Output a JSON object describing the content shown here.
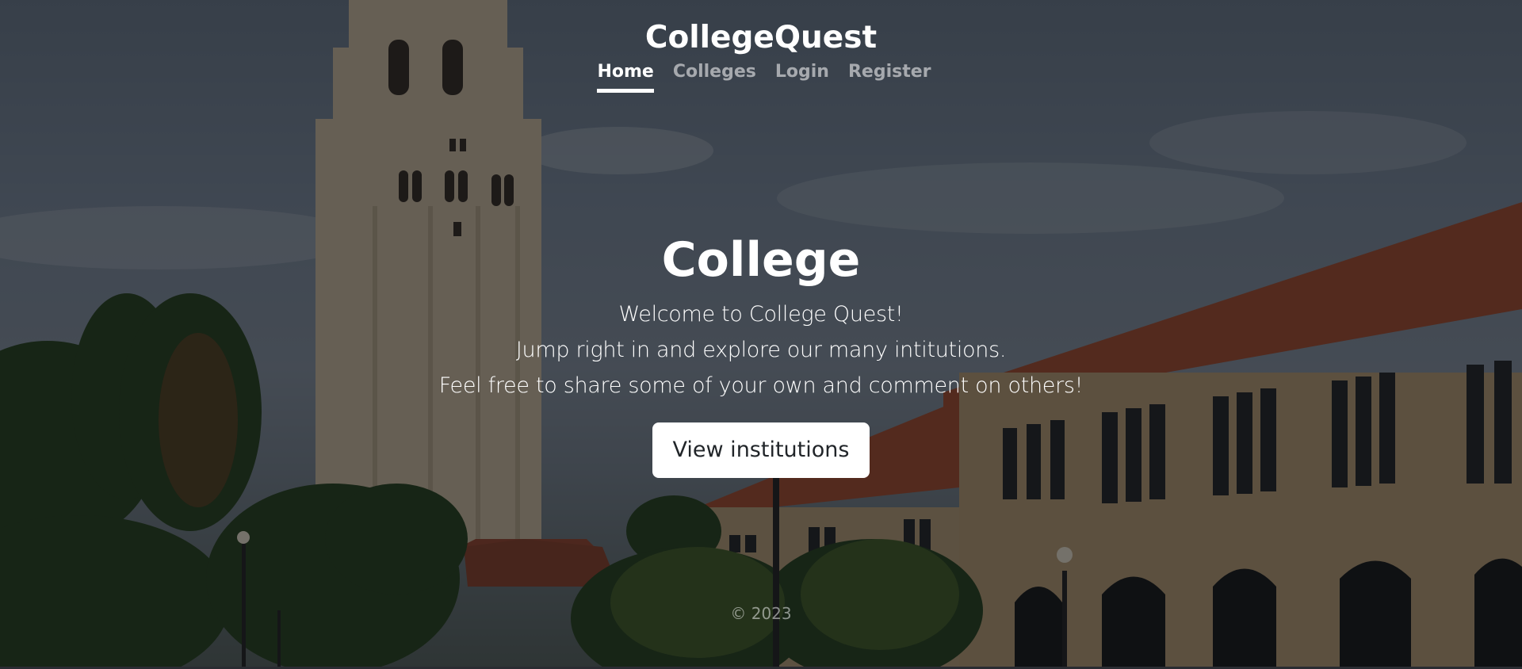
{
  "header": {
    "brand": "CollegeQuest",
    "nav": [
      {
        "label": "Home",
        "active": true
      },
      {
        "label": "Colleges",
        "active": false
      },
      {
        "label": "Login",
        "active": false
      },
      {
        "label": "Register",
        "active": false
      }
    ]
  },
  "hero": {
    "title": "College",
    "lines": [
      "Welcome to College Quest!",
      "Jump right in and explore our many intitutions.",
      "Feel free to share some of your own and comment on others!"
    ],
    "cta_label": "View institutions"
  },
  "footer": {
    "text": "© 2023"
  },
  "colors": {
    "overlay": "#000000",
    "cta_bg": "#ffffff",
    "cta_text": "#212529",
    "nav_active": "#ffffff",
    "nav_inactive": "#9a9a9a"
  }
}
